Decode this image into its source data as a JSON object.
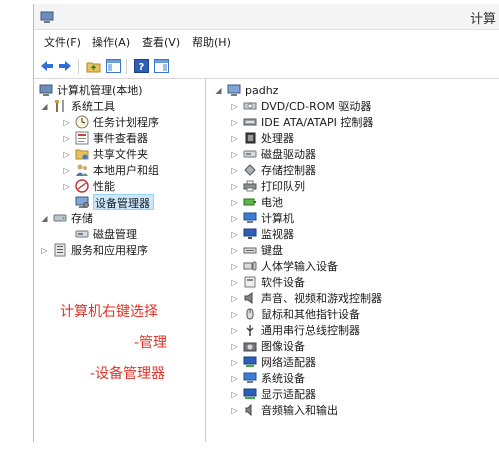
{
  "window": {
    "title": "计算"
  },
  "menu": [
    "文件(F)",
    "操作(A)",
    "查看(V)",
    "帮助(H)"
  ],
  "tree_left": {
    "root": "计算机管理(本地)",
    "system_tools": "系统工具",
    "task_scheduler": "任务计划程序",
    "event_viewer": "事件查看器",
    "shared_folders": "共享文件夹",
    "local_users": "本地用户和组",
    "performance": "性能",
    "device_manager": "设备管理器",
    "storage": "存储",
    "disk_management": "磁盘管理",
    "services_apps": "服务和应用程序"
  },
  "tree_right": {
    "computer_name": "padhz",
    "devices": [
      "DVD/CD-ROM 驱动器",
      "IDE ATA/ATAPI 控制器",
      "处理器",
      "磁盘驱动器",
      "存储控制器",
      "打印队列",
      "电池",
      "计算机",
      "监视器",
      "键盘",
      "人体学输入设备",
      "软件设备",
      "声音、视频和游戏控制器",
      "鼠标和其他指针设备",
      "通用串行总线控制器",
      "图像设备",
      "网络适配器",
      "系统设备",
      "显示适配器",
      "音频输入和输出"
    ]
  },
  "annotation": {
    "line1": "计算机右键选择",
    "line2": "-管理",
    "line3": "-设备管理器"
  },
  "colors": {
    "annotation": "#e0342a",
    "selection": "#cce8ff",
    "accent": "#2f6fd6"
  }
}
